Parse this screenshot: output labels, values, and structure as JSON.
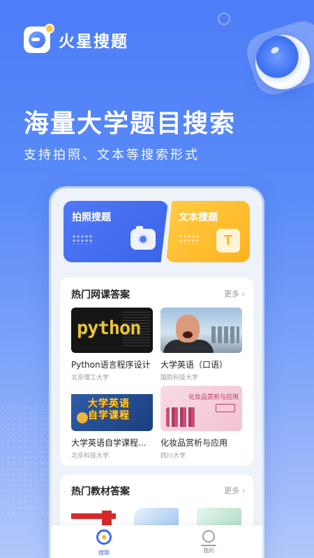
{
  "brand": {
    "name": "火星搜题",
    "logo_icon": "planet-logo-icon"
  },
  "hero": {
    "title": "海量大学题目搜索",
    "subtitle": "支持拍照、文本等搜索形式"
  },
  "tools": [
    {
      "label": "拍照搜题",
      "icon": "camera-icon",
      "color": "#4f79f6"
    },
    {
      "label": "文本搜题",
      "icon": "text-t-icon",
      "color": "#ffb21f"
    }
  ],
  "courses_section": {
    "title": "热门网课答案",
    "more": "更多 ›",
    "items": [
      {
        "title": "Python语言程序设计",
        "school": "北京理工大学",
        "thumb_text": "python"
      },
      {
        "title": "大学英语（口语）",
        "school": "国防科技大学"
      },
      {
        "title": "大学英语自学课程...",
        "school": "北京科技大学",
        "thumb_text": "大学英语\n自学课程"
      },
      {
        "title": "化妆品赏析与应用",
        "school": "四川大学",
        "thumb_text": "化妆品赏析与应用"
      }
    ]
  },
  "books_section": {
    "title": "热门教材答案",
    "more": "更多 ›"
  },
  "tabbar": {
    "items": [
      {
        "label": "搜题",
        "active": true,
        "icon": "search-planet-icon"
      },
      {
        "label": "我的",
        "active": false,
        "icon": "user-icon"
      }
    ]
  },
  "colors": {
    "primary": "#3d6af0",
    "accent": "#ffb21f",
    "background": "#4d7df7"
  }
}
